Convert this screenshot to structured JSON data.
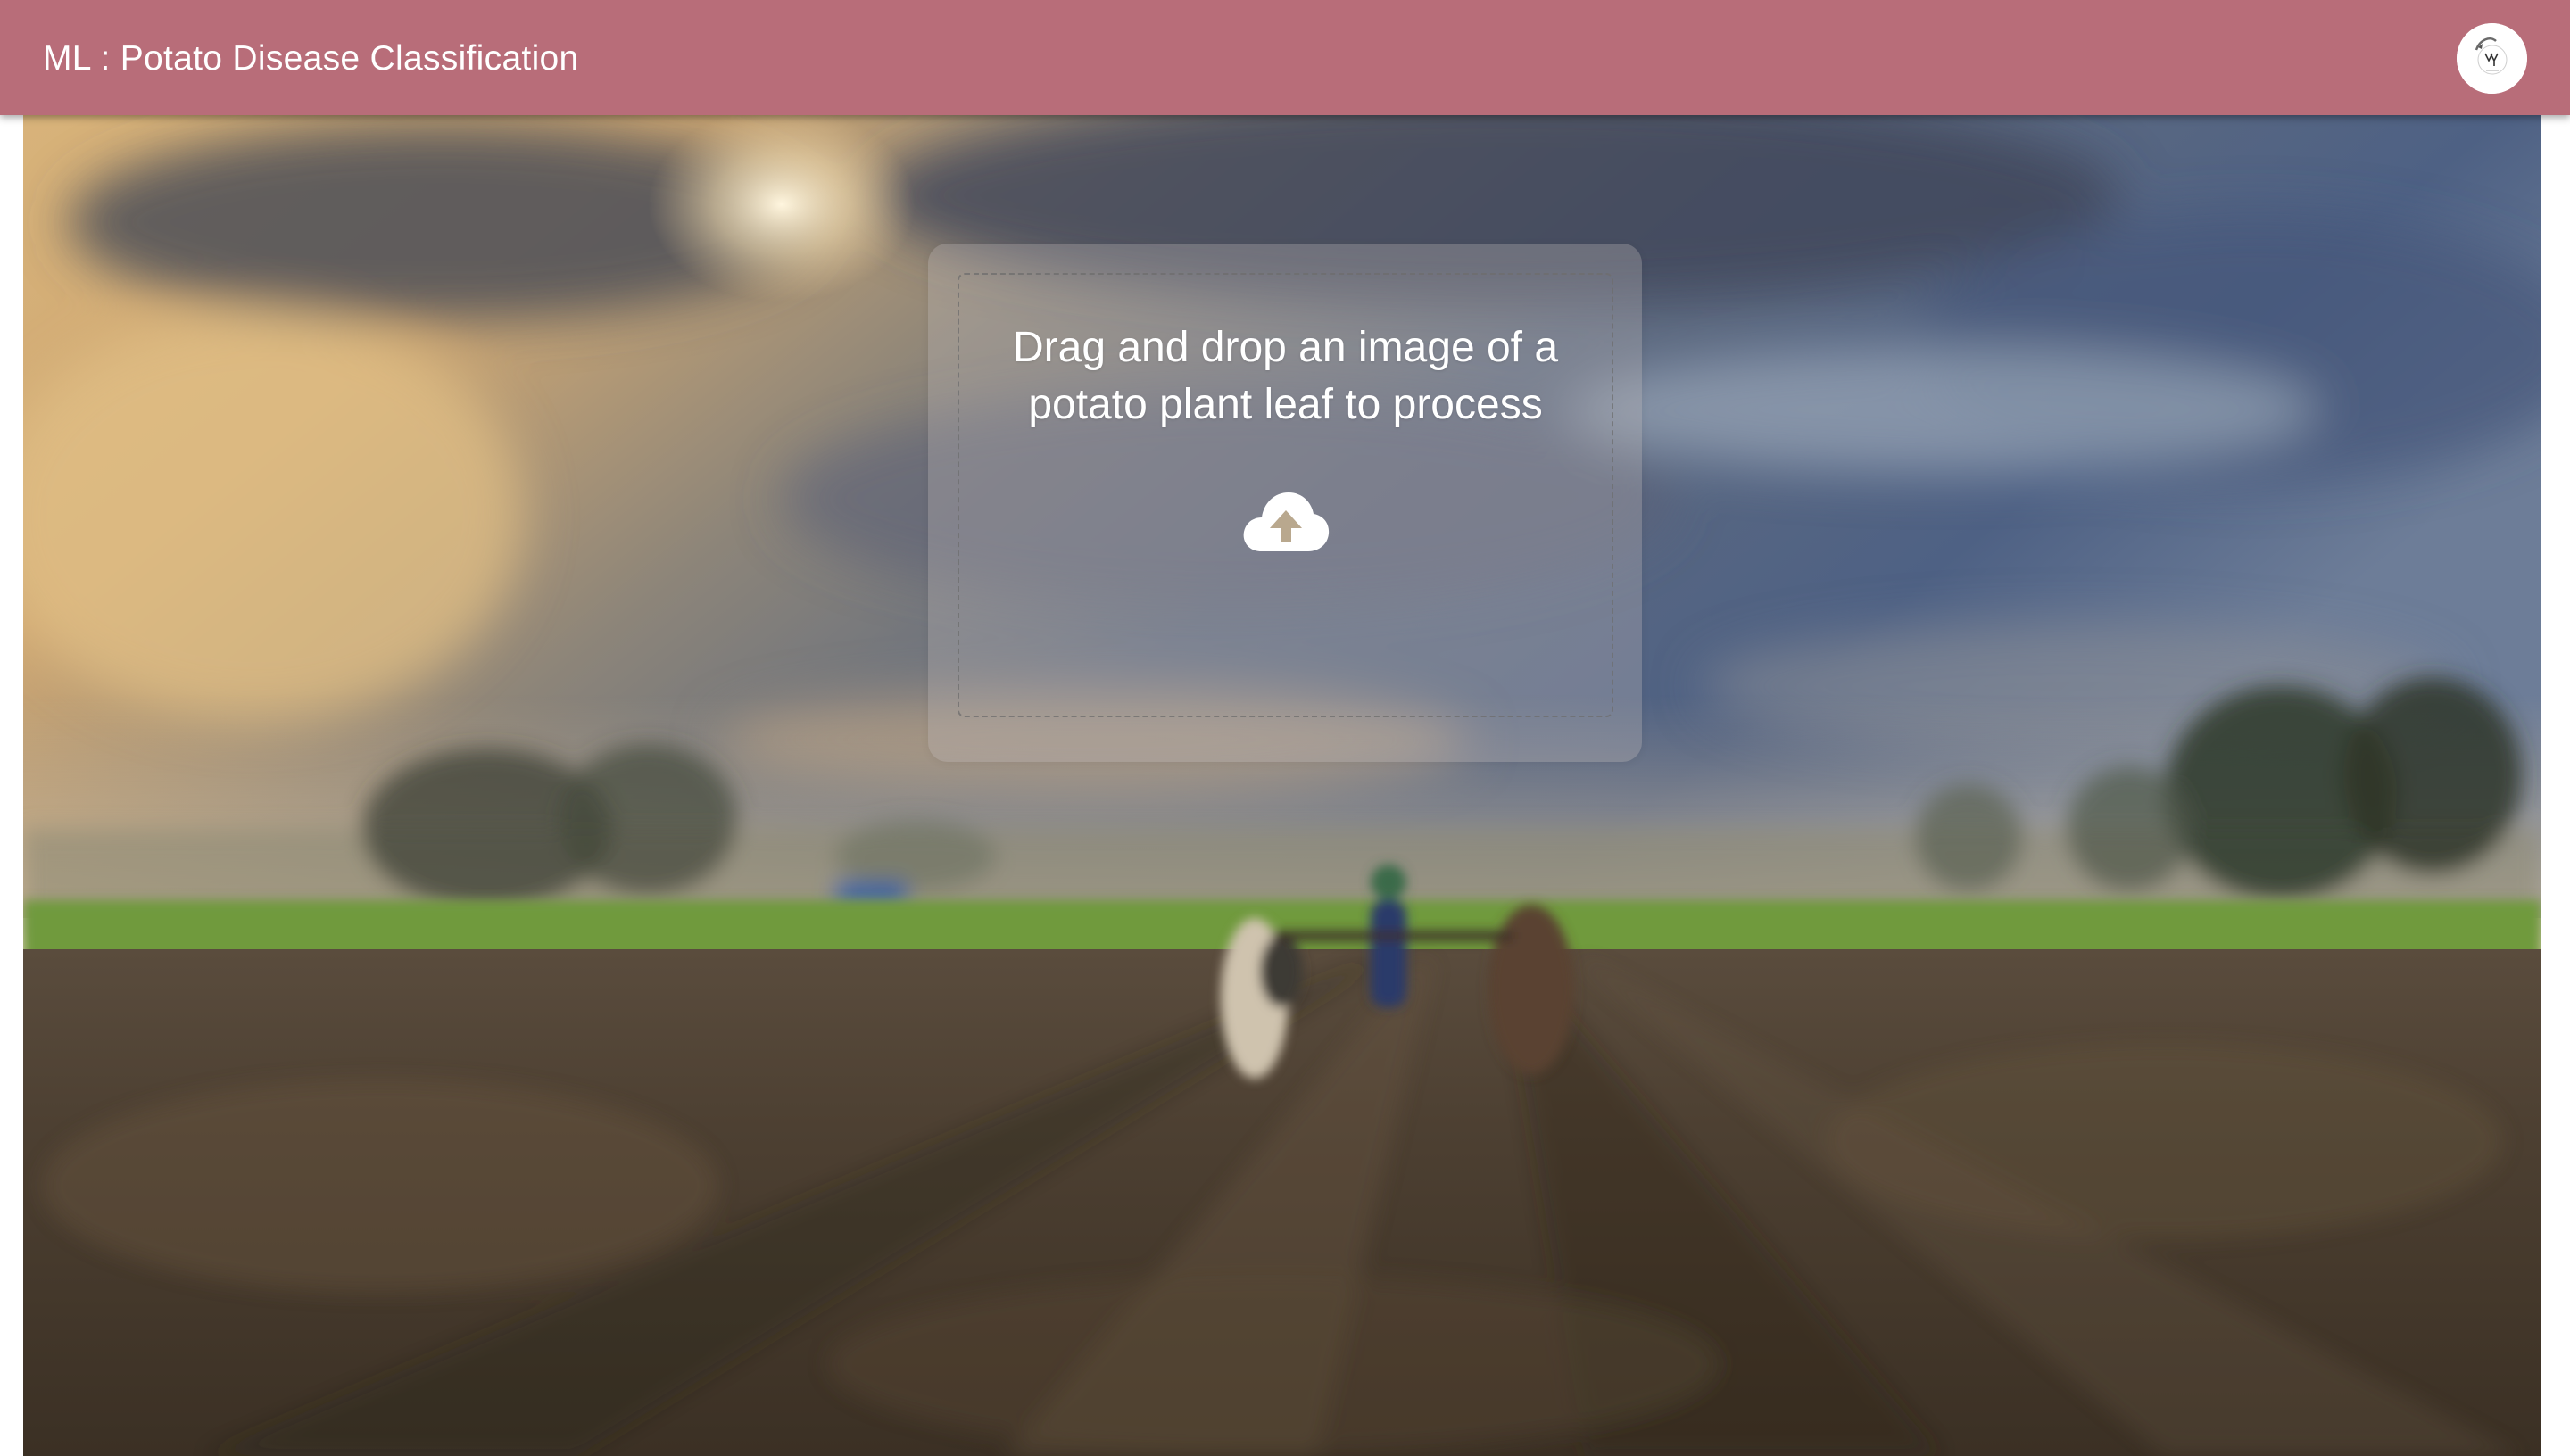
{
  "header": {
    "title": "ML : Potato Disease Classification",
    "background_color": "#b86d79",
    "avatar_icon": "user-avatar-icon"
  },
  "upload": {
    "prompt": "Drag and drop an image of a potato plant leaf to process",
    "icon": "cloud-upload-icon"
  },
  "background": {
    "icon": "farm-field-background-image"
  }
}
